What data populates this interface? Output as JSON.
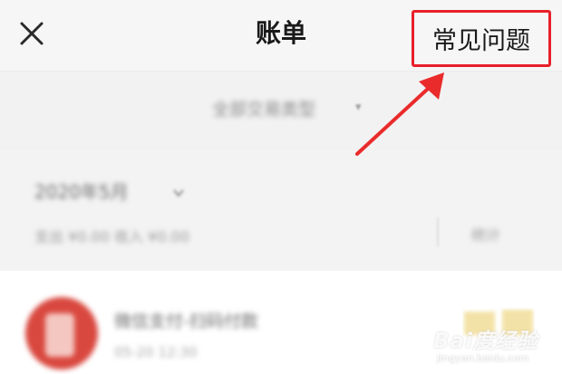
{
  "header": {
    "title": "账单",
    "close_icon": "close-icon",
    "faq_label": "常见问题"
  },
  "filter": {
    "label": "全部交易类型",
    "chevron": "▾"
  },
  "month": {
    "label": "2020年5月",
    "summary": "支出 ¥0.00  收入 ¥0.00",
    "stats": "统计"
  },
  "bill": {
    "name": "微信支付-扫码付款",
    "sub": "05-20 12:30"
  },
  "watermark": {
    "main": "Bai度经验",
    "sub": "jingyan.baidu.com"
  },
  "colors": {
    "highlight": "#e8202a",
    "arrow": "#ea2b2b",
    "title": "#1a1a1a",
    "logo": "#d9483f"
  }
}
